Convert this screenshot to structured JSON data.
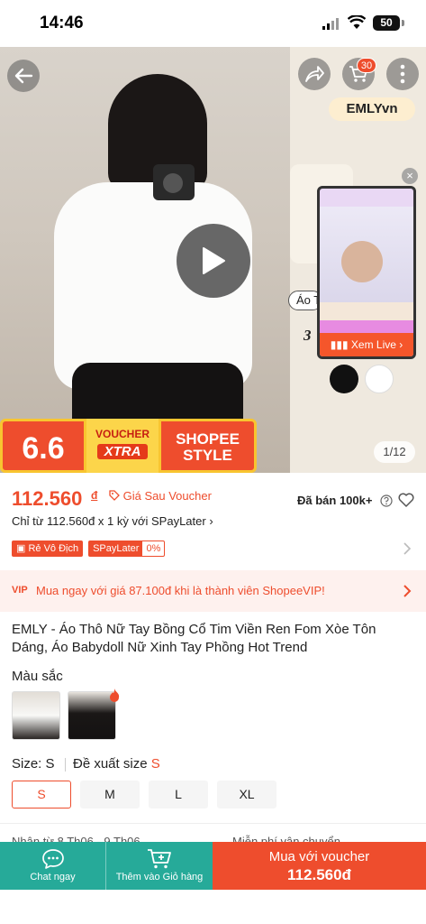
{
  "status_bar": {
    "time": "14:46",
    "battery": "50"
  },
  "media": {
    "cart_count": "30",
    "side_brand": "EMLYvn",
    "side_chip": "Áo T",
    "side_num": "3",
    "live_label": "Xem Live",
    "counter": "1/12",
    "promo": {
      "sale": "6.6",
      "voucher_top": "VOUCHER",
      "voucher_xtra": "XTRA",
      "style_top": "SHOPEE",
      "style_bottom": "STYLE"
    }
  },
  "price": {
    "value": "112.560",
    "currency": "đ",
    "voucher_label": "Giá Sau Voucher",
    "sold": "Đã bán 100k+",
    "installment": "Chỉ từ 112.560đ x 1 kỳ với SPayLater"
  },
  "badges": {
    "cheapest": "Rẻ Vô Địch",
    "spaylater": "SPayLater",
    "percent": "0%"
  },
  "vip": {
    "tag": "VIP",
    "text": "Mua ngay với giá 87.100đ khi là thành viên ShopeeVIP!"
  },
  "product": {
    "title": "EMLY - Áo Thô Nữ Tay Bồng Cổ Tim Viền Ren Fom Xòe Tôn Dáng, Áo Babydoll Nữ Xinh Tay Phồng Hot Trend"
  },
  "variants": {
    "color_label": "Màu sắc",
    "size_label": "Size: S",
    "suggest_label": "Đề xuất size",
    "suggest_value": "S",
    "sizes": [
      "S",
      "M",
      "L",
      "XL"
    ]
  },
  "shipping": {
    "left": "Nhận từ 8 Th06 - 9 Th06",
    "right": "Miễn phí vận chuyển"
  },
  "bottom_bar": {
    "chat": "Chat ngay",
    "cart": "Thêm vào Giỏ hàng",
    "buy_line1": "Mua với voucher",
    "buy_line2": "112.560đ"
  },
  "colors": {
    "accent": "#ee4d2d",
    "teal": "#26aa99"
  }
}
